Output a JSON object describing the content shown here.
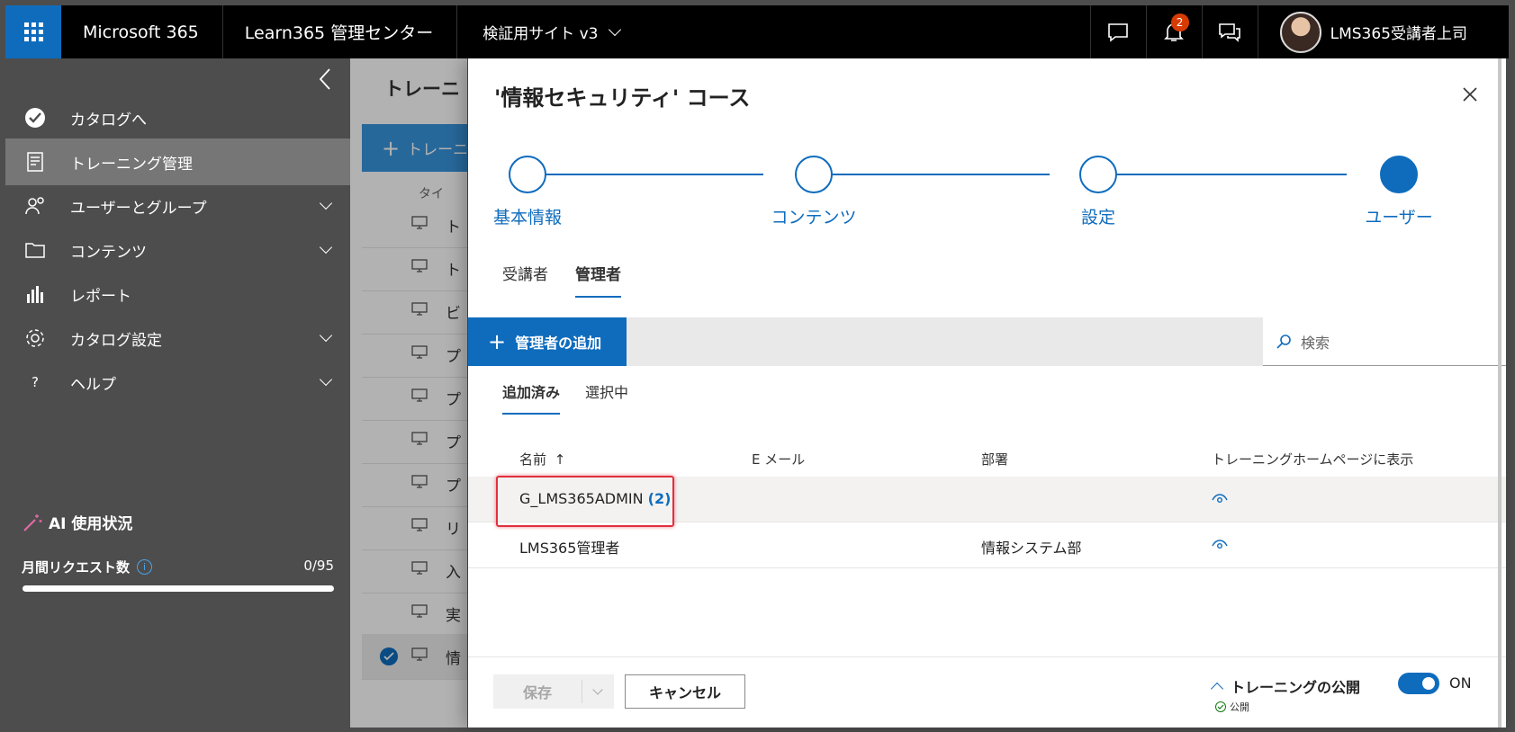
{
  "topbar": {
    "brand": "Microsoft 365",
    "admin_title": "Learn365 管理センター",
    "site": "検証用サイト v3",
    "notification_count": "2",
    "user_name": "LMS365受講者上司"
  },
  "leftnav": {
    "items": [
      {
        "label": "カタログへ",
        "icon": "catalog-icon"
      },
      {
        "label": "トレーニング管理",
        "icon": "training-icon"
      },
      {
        "label": "ユーザーとグループ",
        "icon": "users-icon"
      },
      {
        "label": "コンテンツ",
        "icon": "folder-icon"
      },
      {
        "label": "レポート",
        "icon": "chart-icon"
      },
      {
        "label": "カタログ設定",
        "icon": "gear-icon"
      },
      {
        "label": "ヘルプ",
        "icon": "help-icon"
      }
    ],
    "ai_title": "AI 使用状況",
    "requests_label": "月間リクエスト数",
    "requests_value": "0/95",
    "requests_fraction": 0
  },
  "background_page": {
    "title": "トレーニ",
    "add_button": "トレーニ",
    "header": "タイ",
    "rows": [
      "ト",
      "ト",
      "ビ",
      "プ",
      "プ",
      "プ",
      "プ",
      "リ",
      "入",
      "実",
      "情"
    ]
  },
  "panel": {
    "title": "'情報セキュリティ' コース",
    "steps": [
      "基本情報",
      "コンテンツ",
      "設定",
      "ユーザー"
    ],
    "tabs": [
      "受講者",
      "管理者"
    ],
    "add_button": "管理者の追加",
    "search_placeholder": "検索",
    "subtabs": [
      "追加済み",
      "選択中"
    ],
    "columns": {
      "name": "名前",
      "email": "E メール",
      "department": "部署",
      "show_on_home": "トレーニングホームページに表示"
    },
    "rows": [
      {
        "name": "G_LMS365ADMIN",
        "count": "(2)",
        "email": "",
        "department": ""
      },
      {
        "name": "LMS365管理者",
        "count": "",
        "email": "",
        "department": "情報システム部"
      }
    ],
    "footer": {
      "save": "保存",
      "cancel": "キャンセル",
      "publish_label": "トレーニングの公開",
      "publish_status": "公開",
      "toggle_label": "ON"
    }
  },
  "colors": {
    "accent": "#0f6cbd",
    "nav_bg": "#4d4d4d",
    "topbar_bg": "#000000",
    "highlight_box": "#e0303f"
  }
}
